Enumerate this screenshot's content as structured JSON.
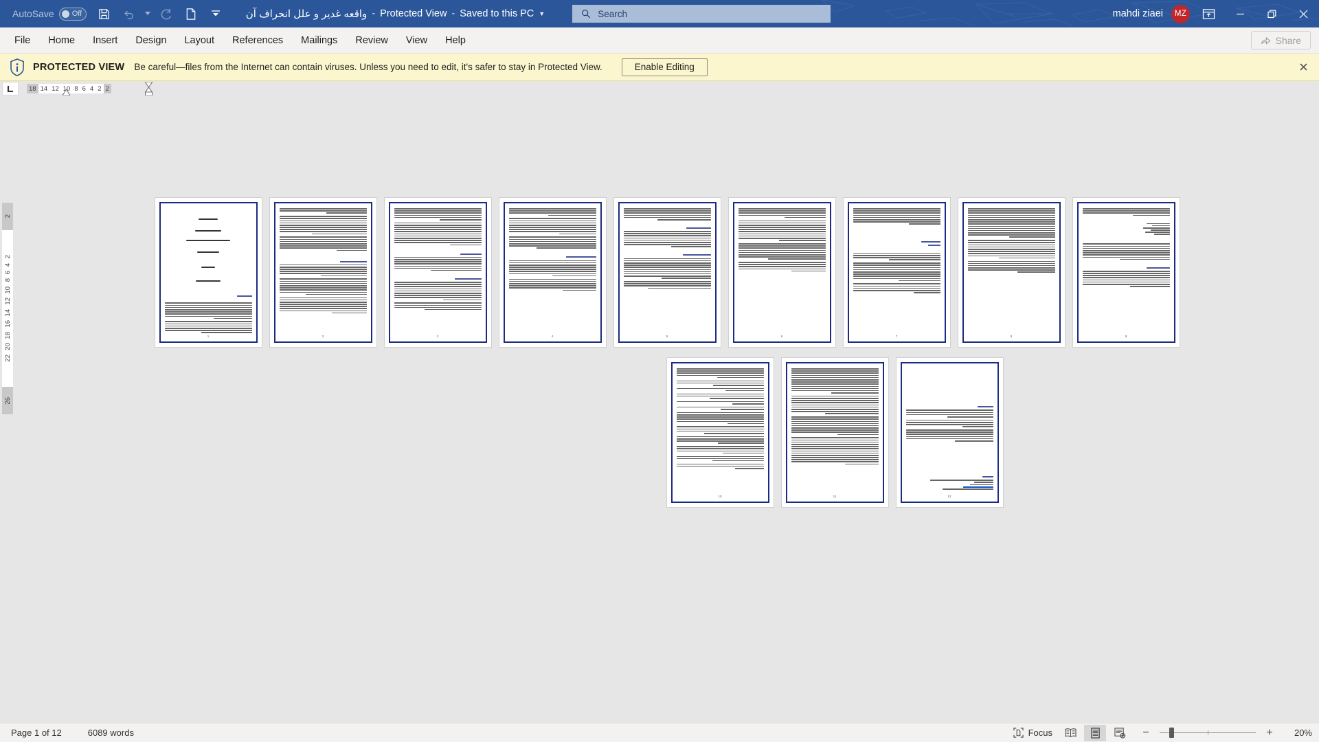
{
  "titlebar": {
    "autosave_label": "AutoSave",
    "autosave_state": "Off",
    "save_icon": "save-icon",
    "undo_icon": "undo-icon",
    "redo_icon": "redo-icon",
    "new_icon": "new-document-icon",
    "customize_icon": "customize-quick-access-toolbar-icon",
    "document_name": "واقعه غدیر و علل انحراف آن",
    "sep1": "-",
    "protected_view": "Protected View",
    "sep2": "-",
    "saved_location": "Saved to this PC",
    "search_placeholder": "Search",
    "search_value": "",
    "user_name": "mahdi ziaei",
    "user_initials": "MZ",
    "ribbon_display_icon": "ribbon-display-options-icon",
    "minimize_icon": "minimize-icon",
    "restore_icon": "restore-icon",
    "close_icon": "close-icon",
    "bg_color": "#2b579a",
    "avatar_color": "#c0272d"
  },
  "ribbon": {
    "tabs": [
      {
        "label": "File"
      },
      {
        "label": "Home"
      },
      {
        "label": "Insert"
      },
      {
        "label": "Design"
      },
      {
        "label": "Layout"
      },
      {
        "label": "References"
      },
      {
        "label": "Mailings"
      },
      {
        "label": "Review"
      },
      {
        "label": "View"
      },
      {
        "label": "Help"
      }
    ],
    "share_label": "Share",
    "share_enabled": false
  },
  "protected_view_banner": {
    "icon": "info-shield-icon",
    "title": "PROTECTED VIEW",
    "message": "Be careful—files from the Internet can contain viruses. Unless you need to edit, it's safer to stay in Protected View.",
    "button_label": "Enable Editing",
    "close_icon": "close-icon",
    "background": "#fbf6cd"
  },
  "horizontal_ruler": {
    "tabstop_icon": "left-tab-stop-icon",
    "ticks": [
      "18",
      "14",
      "12",
      "10",
      "8",
      "6",
      "4",
      "2",
      "2"
    ],
    "left_indent_marker": "first-line-indent-marker",
    "right_indent_marker": "hanging-indent-marker"
  },
  "vertical_ruler": {
    "ticks": [
      "2",
      "2",
      "4",
      "6",
      "8",
      "10",
      "12",
      "14",
      "16",
      "18",
      "20",
      "22",
      "26"
    ]
  },
  "document": {
    "page_count": 12,
    "zoom_percent": 20,
    "rows": [
      {
        "pages": [
          {
            "number": "1",
            "type": "cover"
          },
          {
            "number": "2",
            "type": "text"
          },
          {
            "number": "3",
            "type": "text"
          },
          {
            "number": "4",
            "type": "text"
          },
          {
            "number": "5",
            "type": "text"
          },
          {
            "number": "6",
            "type": "text"
          },
          {
            "number": "7",
            "type": "text"
          },
          {
            "number": "8",
            "type": "text"
          },
          {
            "number": "9",
            "type": "list"
          }
        ]
      },
      {
        "pages": [
          {
            "number": "10",
            "type": "text"
          },
          {
            "number": "11",
            "type": "text"
          },
          {
            "number": "12",
            "type": "references"
          }
        ]
      }
    ],
    "cover_text": {
      "bismillah": "به نام خدا",
      "subject_label": "موضوع تحقیق :",
      "subject_value": "واقعه غدیر و علل انحراف آن",
      "teacher_label": "نام استاد :",
      "course_label": "درس :",
      "student_label": "نام دانشجو:"
    },
    "references_page": {
      "heading": "منابع",
      "items": [
        "سبحانی، جعفر ، (1388) ، فروغ ابدیت، چاپ بیست و نهم، قم: بوستان کتاب",
        "نهج البلاغه",
        "بحارالانوار",
        "https://hawzah.net",
        "https://ayandehroshan.ir/article_1477.html"
      ]
    }
  },
  "statusbar": {
    "page_status": "Page 1 of 12",
    "word_count": "6089 words",
    "focus_label": "Focus",
    "focus_icon": "focus-mode-icon",
    "read_mode_icon": "read-mode-icon",
    "print_layout_icon": "print-layout-icon",
    "web_layout_icon": "web-layout-icon",
    "zoom_out_label": "−",
    "zoom_in_label": "+",
    "zoom_level": "20%",
    "active_view": "print-layout"
  }
}
